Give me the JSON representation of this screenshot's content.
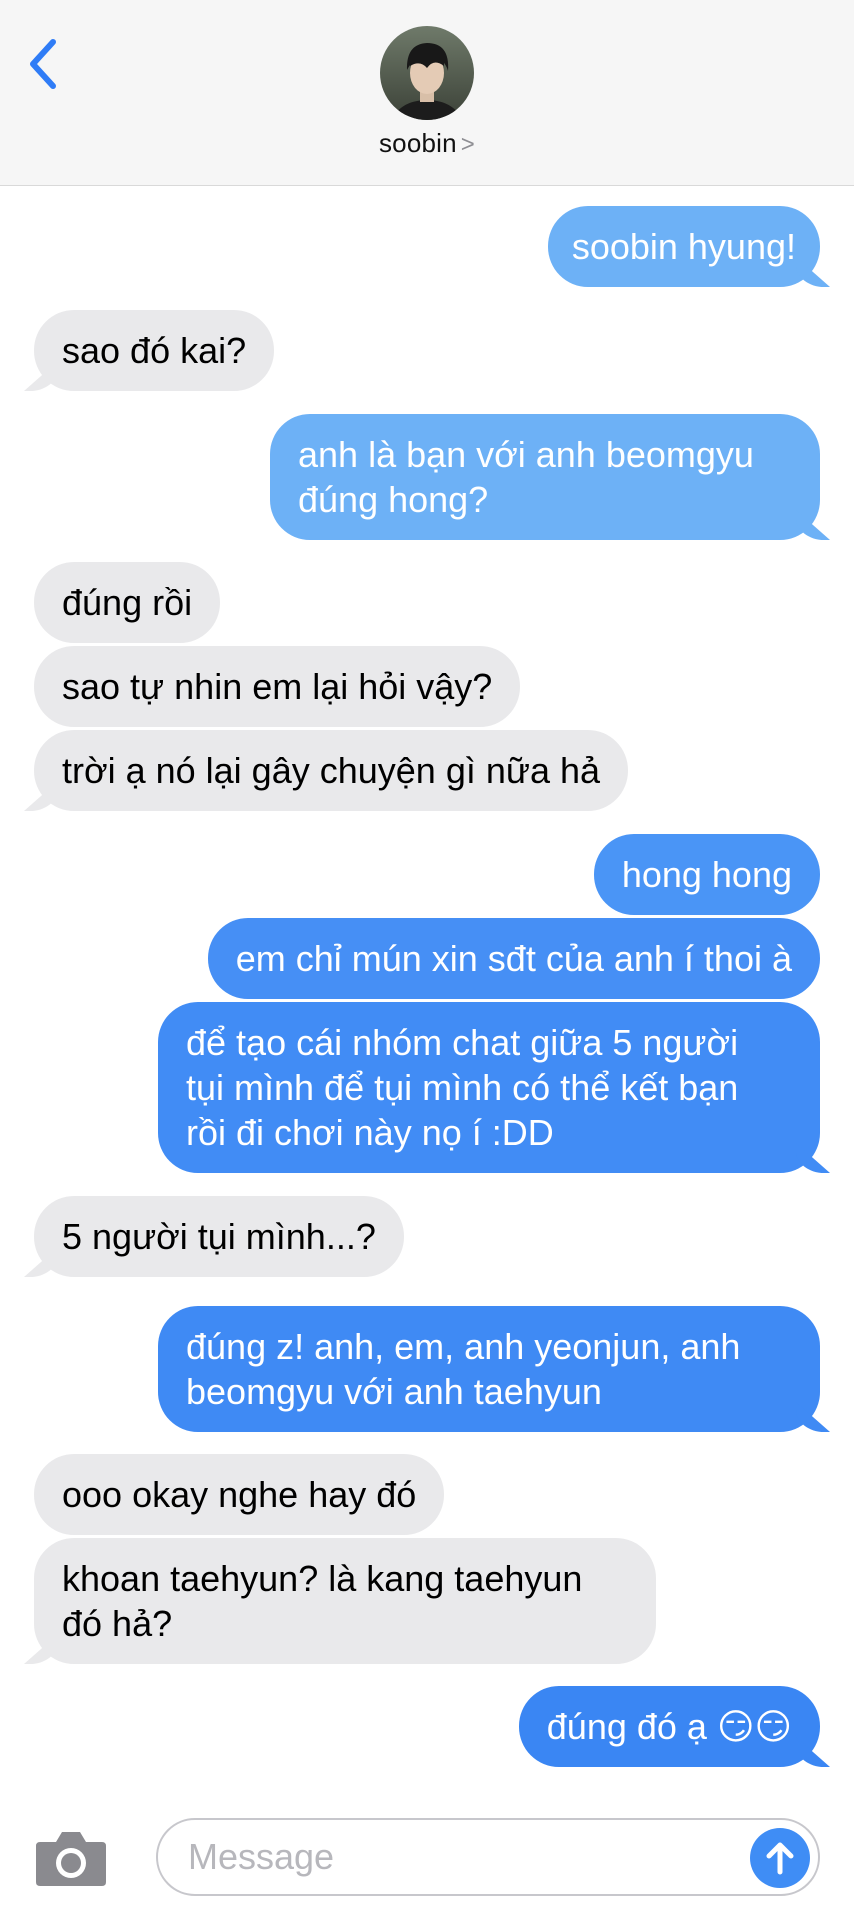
{
  "header": {
    "contact_name": "soobin",
    "chevron": ">"
  },
  "colors": {
    "sent_bubble": "#3f8df5",
    "sent_bubble_light": "#6db1f6",
    "received_bubble": "#e9e9eb",
    "accent": "#2f7cf6"
  },
  "messages": [
    {
      "side": "sent",
      "text": "soobin hyung!"
    },
    {
      "side": "received",
      "text": "sao đó kai?"
    },
    {
      "side": "sent",
      "lines": [
        "anh là bạn với anh beomgyu",
        "đúng hong?"
      ]
    },
    {
      "side": "received",
      "text": "đúng rồi"
    },
    {
      "side": "received",
      "text": "sao tự nhin em lại hỏi vậy?"
    },
    {
      "side": "received",
      "text": "trời ạ nó lại gây chuyện gì nữa hả"
    },
    {
      "side": "sent",
      "text": "hong hong"
    },
    {
      "side": "sent",
      "text": "em chỉ mún xin sđt của anh í thoi à"
    },
    {
      "side": "sent",
      "lines": [
        "để tạo cái nhóm chat giữa 5 người",
        "tụi mình để tụi mình có thể kết bạn",
        "rồi đi chơi này nọ í :DD"
      ]
    },
    {
      "side": "received",
      "text": "5 người tụi mình...?"
    },
    {
      "side": "sent",
      "lines": [
        "đúng z! anh, em, anh yeonjun, anh",
        "beomgyu với anh taehyun"
      ]
    },
    {
      "side": "received",
      "text": "ooo okay nghe hay đó"
    },
    {
      "side": "received",
      "lines": [
        "khoan taehyun? là kang taehyun",
        "đó hả?"
      ]
    },
    {
      "side": "sent",
      "text": "đúng đó ạ 😏😏"
    }
  ],
  "composer": {
    "placeholder": "Message"
  },
  "icons": {
    "back": "chevron-left-icon",
    "camera": "camera-icon",
    "send": "arrow-up-icon"
  }
}
